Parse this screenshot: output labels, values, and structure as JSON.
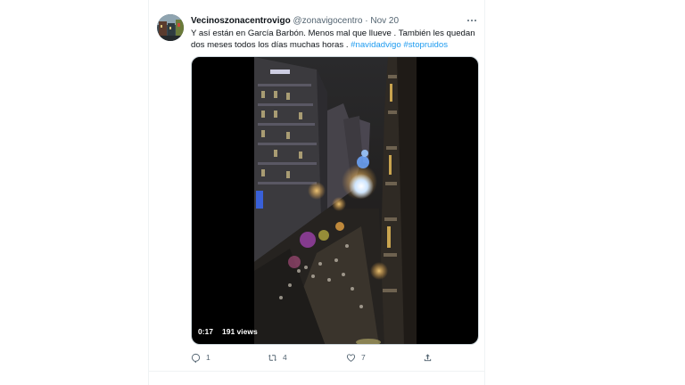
{
  "tweet": {
    "display_name": "Vecinoszonacentrovigo",
    "handle": "@zonavigocentro",
    "separator": "·",
    "date": "Nov 20",
    "text_line1": "Y así están en García Barbón. Menos mal que llueve . También les quedan",
    "text_line2": "dos meses todos los días muchas horas . ",
    "hashtags": [
      "#navidadvigo",
      "#stopruidos"
    ]
  },
  "video": {
    "elapsed": "0:17",
    "views": "191 views"
  },
  "actions": {
    "reply": {
      "icon": "reply-icon",
      "count": "1"
    },
    "retweet": {
      "icon": "retweet-icon",
      "count": "4"
    },
    "like": {
      "icon": "heart-icon",
      "count": "7"
    },
    "share": {
      "icon": "share-icon"
    }
  },
  "colors": {
    "link": "#1d9bf0",
    "secondary_text": "#536471"
  }
}
